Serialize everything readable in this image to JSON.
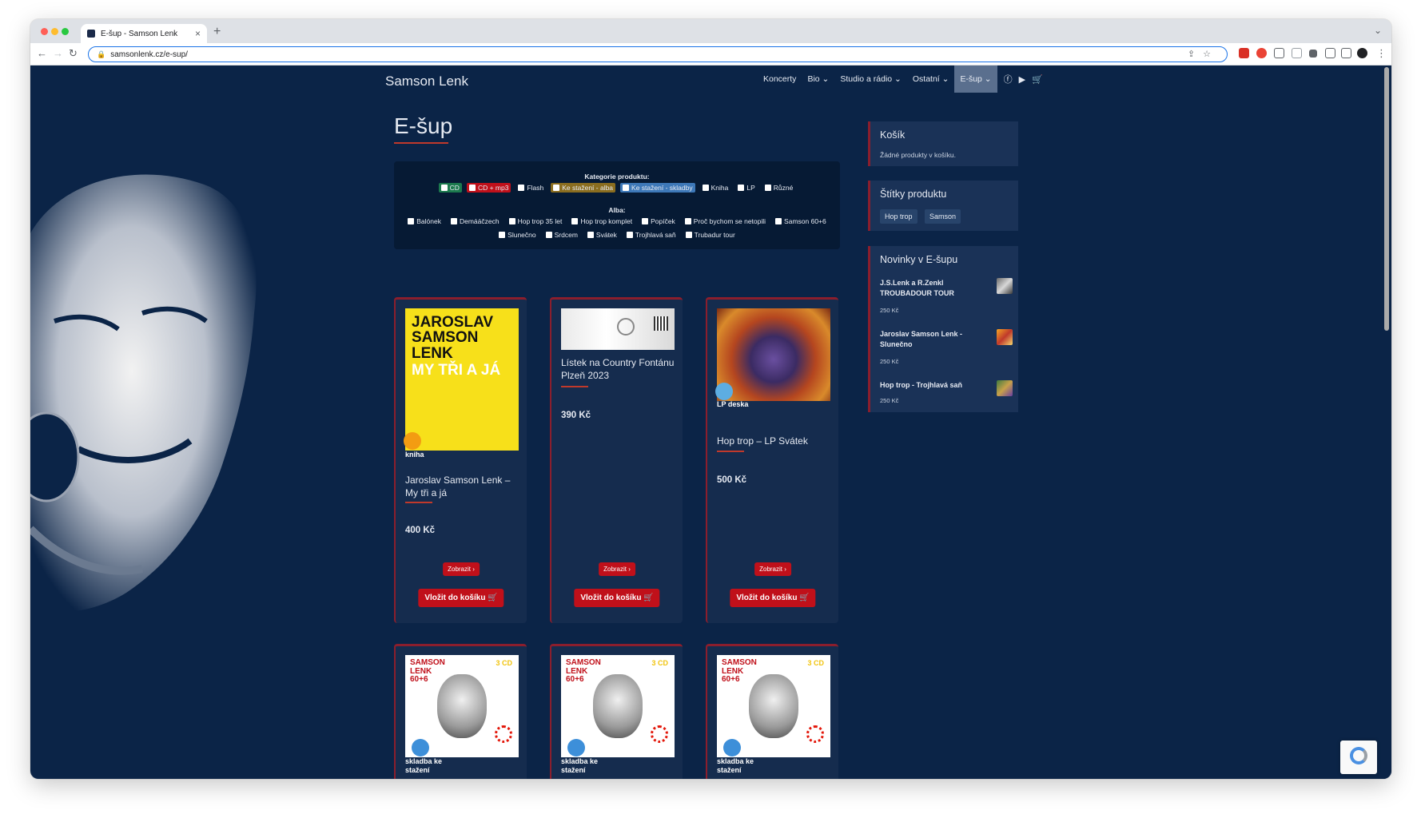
{
  "browser": {
    "tab_title": "E-šup - Samson Lenk",
    "url": "samsonlenk.cz/e-sup/"
  },
  "site": {
    "brand": "Samson Lenk",
    "nav": [
      "Koncerty",
      "Bio ⌄",
      "Studio a rádio ⌄",
      "Ostatní ⌄",
      "E-šup ⌄"
    ],
    "page_title": "E-šup"
  },
  "filters": {
    "category_label": "Kategorie produktu:",
    "categories": [
      "CD",
      "CD + mp3",
      "Flash",
      "Ke stažení - alba",
      "Ke stažení - skladby",
      "Kniha",
      "LP",
      "Různé"
    ],
    "category_colors": [
      "#1c7a4e",
      "#c0101a",
      "",
      "#8a6d1f",
      "#3d78b8",
      "",
      "",
      ""
    ],
    "albums_label": "Alba:",
    "albums_row1": [
      "Balónek",
      "Demááčzech",
      "Hop trop 35 let",
      "Hop trop komplet",
      "Popíček",
      "Proč bychom se netopili",
      "Samson 60+6"
    ],
    "albums_row2": [
      "Slunečno",
      "Srdcem",
      "Svátek",
      "Trojhlavá saň",
      "Trubadur tour"
    ]
  },
  "sidebar": {
    "cart_title": "Košík",
    "cart_empty": "Žádné produkty v košíku.",
    "tags_title": "Štítky produktu",
    "tags": [
      "Hop trop",
      "Samson"
    ],
    "news_title": "Novinky v E-šupu",
    "news": [
      {
        "name": "J.S.Lenk a R.Zenkl TROUBADOUR TOUR",
        "price": "250 Kč"
      },
      {
        "name": "Jaroslav Samson Lenk - Slunečno",
        "price": "250 Kč"
      },
      {
        "name": "Hop trop - Trojhlavá saň",
        "price": "250 Kč"
      }
    ]
  },
  "products": [
    {
      "name": "Jaroslav Samson Lenk – My tři a já",
      "price": "400 Kč",
      "badge": "kniha",
      "cover_text": "JAROSLAV SAMSON LENK",
      "cover_sub": "MY TŘI A JÁ"
    },
    {
      "name": "Lístek na Country Fontánu Plzeň 2023",
      "price": "390 Kč",
      "badge": ""
    },
    {
      "name": "Hop trop – LP Svátek",
      "price": "500 Kč",
      "badge": "LP deska"
    },
    {
      "badge": "skladba ke stažení",
      "cover_text": "SAMSON LENK 60+6",
      "cover_cd": "3 CD"
    },
    {
      "badge": "skladba ke stažení",
      "cover_text": "SAMSON LENK 60+6",
      "cover_cd": "3 CD"
    },
    {
      "badge": "skladba ke stažení",
      "cover_text": "SAMSON LENK 60+6",
      "cover_cd": "3 CD"
    }
  ],
  "buttons": {
    "show": "Zobrazit ›",
    "add_to_cart": "Vložit do košíku 🛒"
  }
}
